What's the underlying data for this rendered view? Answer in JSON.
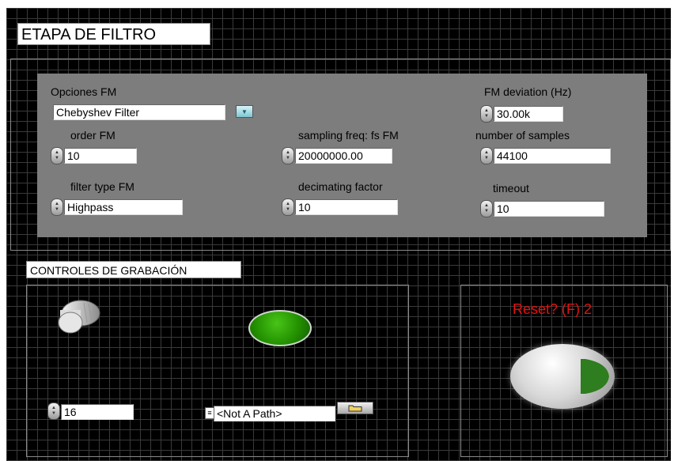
{
  "panel_title": "ETAPA DE FILTRO",
  "filter": {
    "opciones_label": "Opciones FM",
    "opciones_value": "Chebyshev Filter",
    "order_label": "order FM",
    "order_value": "10",
    "filter_type_label": "filter type FM",
    "filter_type_value": "Highpass",
    "sampling_label": "sampling freq: fs FM",
    "sampling_value": "20000000.00",
    "decimating_label": "decimating factor",
    "decimating_value": "10",
    "deviation_label": "FM deviation (Hz)",
    "deviation_value": "30.00k",
    "samples_label": "number of samples",
    "samples_value": "44100",
    "timeout_label": "timeout",
    "timeout_value": "10"
  },
  "recording": {
    "title": "CONTROLES DE GRABACIÓN",
    "numeric_value": "16",
    "path_value": "<Not A Path>"
  },
  "reset": {
    "label": "Reset? (F) 2"
  },
  "colors": {
    "panel_bg": "#000000",
    "cluster_bg": "#7d7d7d",
    "led_green": "#239000",
    "reset_label": "#e81010",
    "reset_arrow": "#2e7d1e"
  }
}
